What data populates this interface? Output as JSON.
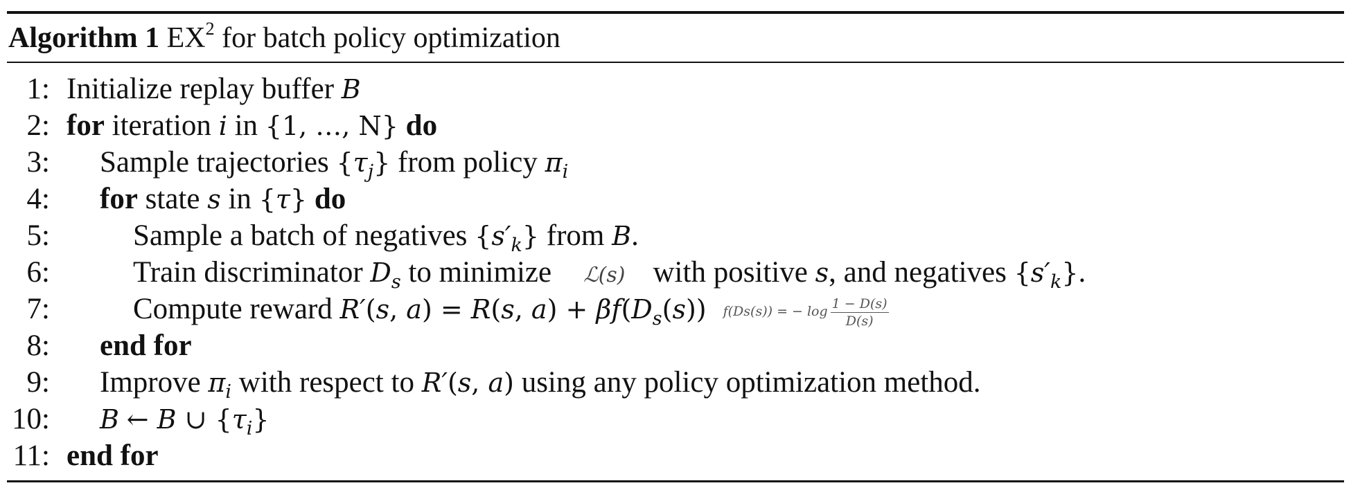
{
  "caption": {
    "label": "Algorithm 1",
    "name": "EX",
    "superscript": "2",
    "rest": "for batch policy optimization"
  },
  "lines": [
    {
      "num": "1:",
      "text": "Initialize replay buffer B"
    },
    {
      "num": "2:",
      "text": "for iteration i in {1, …, N} do"
    },
    {
      "num": "3:",
      "text": "Sample trajectories {τj} from policy πi"
    },
    {
      "num": "4:",
      "text": "for state s in {τ} do"
    },
    {
      "num": "5:",
      "text": "Sample a batch of negatives {s′k} from B."
    },
    {
      "num": "6:",
      "text": "Train discriminator Ds to minimize ℒ(s) with positive s, and negatives {s′k}."
    },
    {
      "num": "7:",
      "text": "Compute reward R′(s, a) = R(s, a) + βf(Ds(s))"
    },
    {
      "num": "8:",
      "text": "end for"
    },
    {
      "num": "9:",
      "text": "Improve πi with respect to R′(s, a) using any policy optimization method."
    },
    {
      "num": "10:",
      "text": "B ← B ∪ {τi}"
    },
    {
      "num": "11:",
      "text": "end for"
    }
  ],
  "inline_annotations": {
    "loss": "ℒ(s)",
    "reward_f_lhs": "f(Ds(s)) = − log",
    "reward_f_numerator": "1 − D(s)",
    "reward_f_denominator": "D(s)"
  },
  "words": {
    "init": "Initialize replay buffer",
    "for": "for",
    "iteration": "iteration",
    "in": "in",
    "set_n": "{1, …, N}",
    "do": "do",
    "sample_traj": "Sample trajectories",
    "from_policy": "from policy",
    "state": "state",
    "sample_neg": "Sample a batch of negatives",
    "from": "from",
    "train": "Train discriminator",
    "to_minimize": "to minimize",
    "with_positive": "with positive",
    "and_negatives": ", and negatives",
    "compute": "Compute reward",
    "end_for": "end for",
    "improve": "Improve",
    "with_respect": "with respect to",
    "using": "using any policy optimization method."
  }
}
